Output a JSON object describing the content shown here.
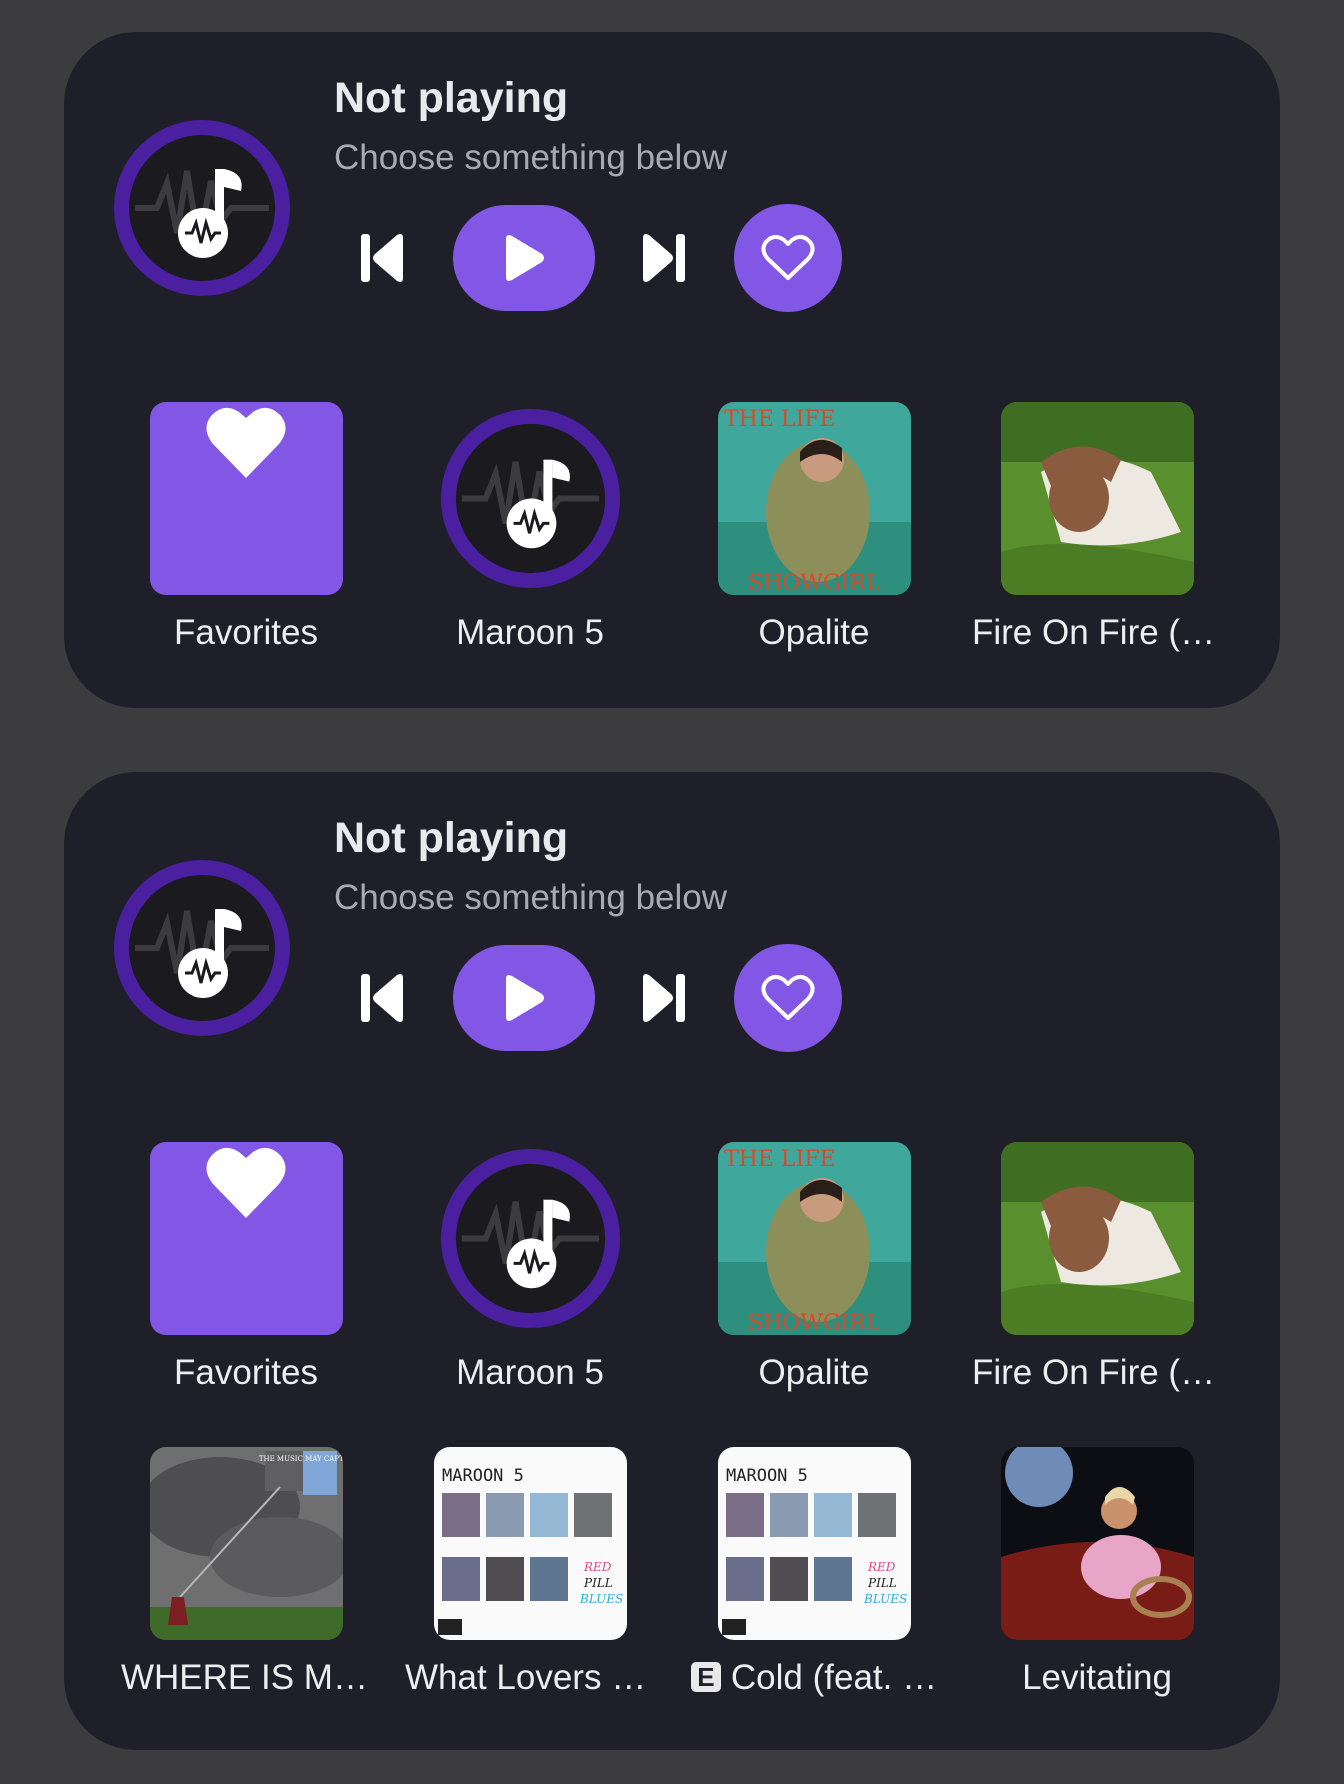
{
  "colors": {
    "background": "#3c3c3f",
    "widget_background": "#1f1f29",
    "accent": "#8257e5",
    "logo_ring": "#4a1fa0",
    "text_primary": "#e9e9ee",
    "text_secondary": "#a9a9b3"
  },
  "widgets": [
    {
      "status_title": "Not playing",
      "status_subtitle": "Choose something below",
      "controls": {
        "prev_icon": "skip-previous-icon",
        "play_icon": "play-icon",
        "next_icon": "skip-next-icon",
        "favorite_icon": "heart-outline-icon"
      },
      "items": [
        {
          "label": "Favorites",
          "art": "heart-icon"
        },
        {
          "label": "Maroon 5",
          "art": "app-logo-icon"
        },
        {
          "label": "Opalite",
          "art": "album-art-teal"
        },
        {
          "label": "Fire On Fire (B…",
          "art": "album-art-grass"
        }
      ]
    },
    {
      "status_title": "Not playing",
      "status_subtitle": "Choose something below",
      "controls": {
        "prev_icon": "skip-previous-icon",
        "play_icon": "play-icon",
        "next_icon": "skip-next-icon",
        "favorite_icon": "heart-outline-icon"
      },
      "items": [
        {
          "label": "Favorites",
          "art": "heart-icon"
        },
        {
          "label": "Maroon 5",
          "art": "app-logo-icon"
        },
        {
          "label": "Opalite",
          "art": "album-art-teal"
        },
        {
          "label": "Fire On Fire (B…",
          "art": "album-art-grass"
        },
        {
          "label": "WHERE IS MY…",
          "art": "album-art-storm",
          "cover_text": "THE MUSIC MAY CAPTAIN HOPE"
        },
        {
          "label": "What Lovers D…",
          "art": "album-art-grid",
          "cover_text": "MAROON 5",
          "cover_text_2": "RED PILL BLUES"
        },
        {
          "label": "Cold (feat. …",
          "art": "album-art-grid",
          "cover_text": "MAROON 5",
          "cover_text_2": "RED PILL BLUES",
          "badge": "E"
        },
        {
          "label": "Levitating",
          "art": "album-art-moon"
        }
      ]
    }
  ]
}
